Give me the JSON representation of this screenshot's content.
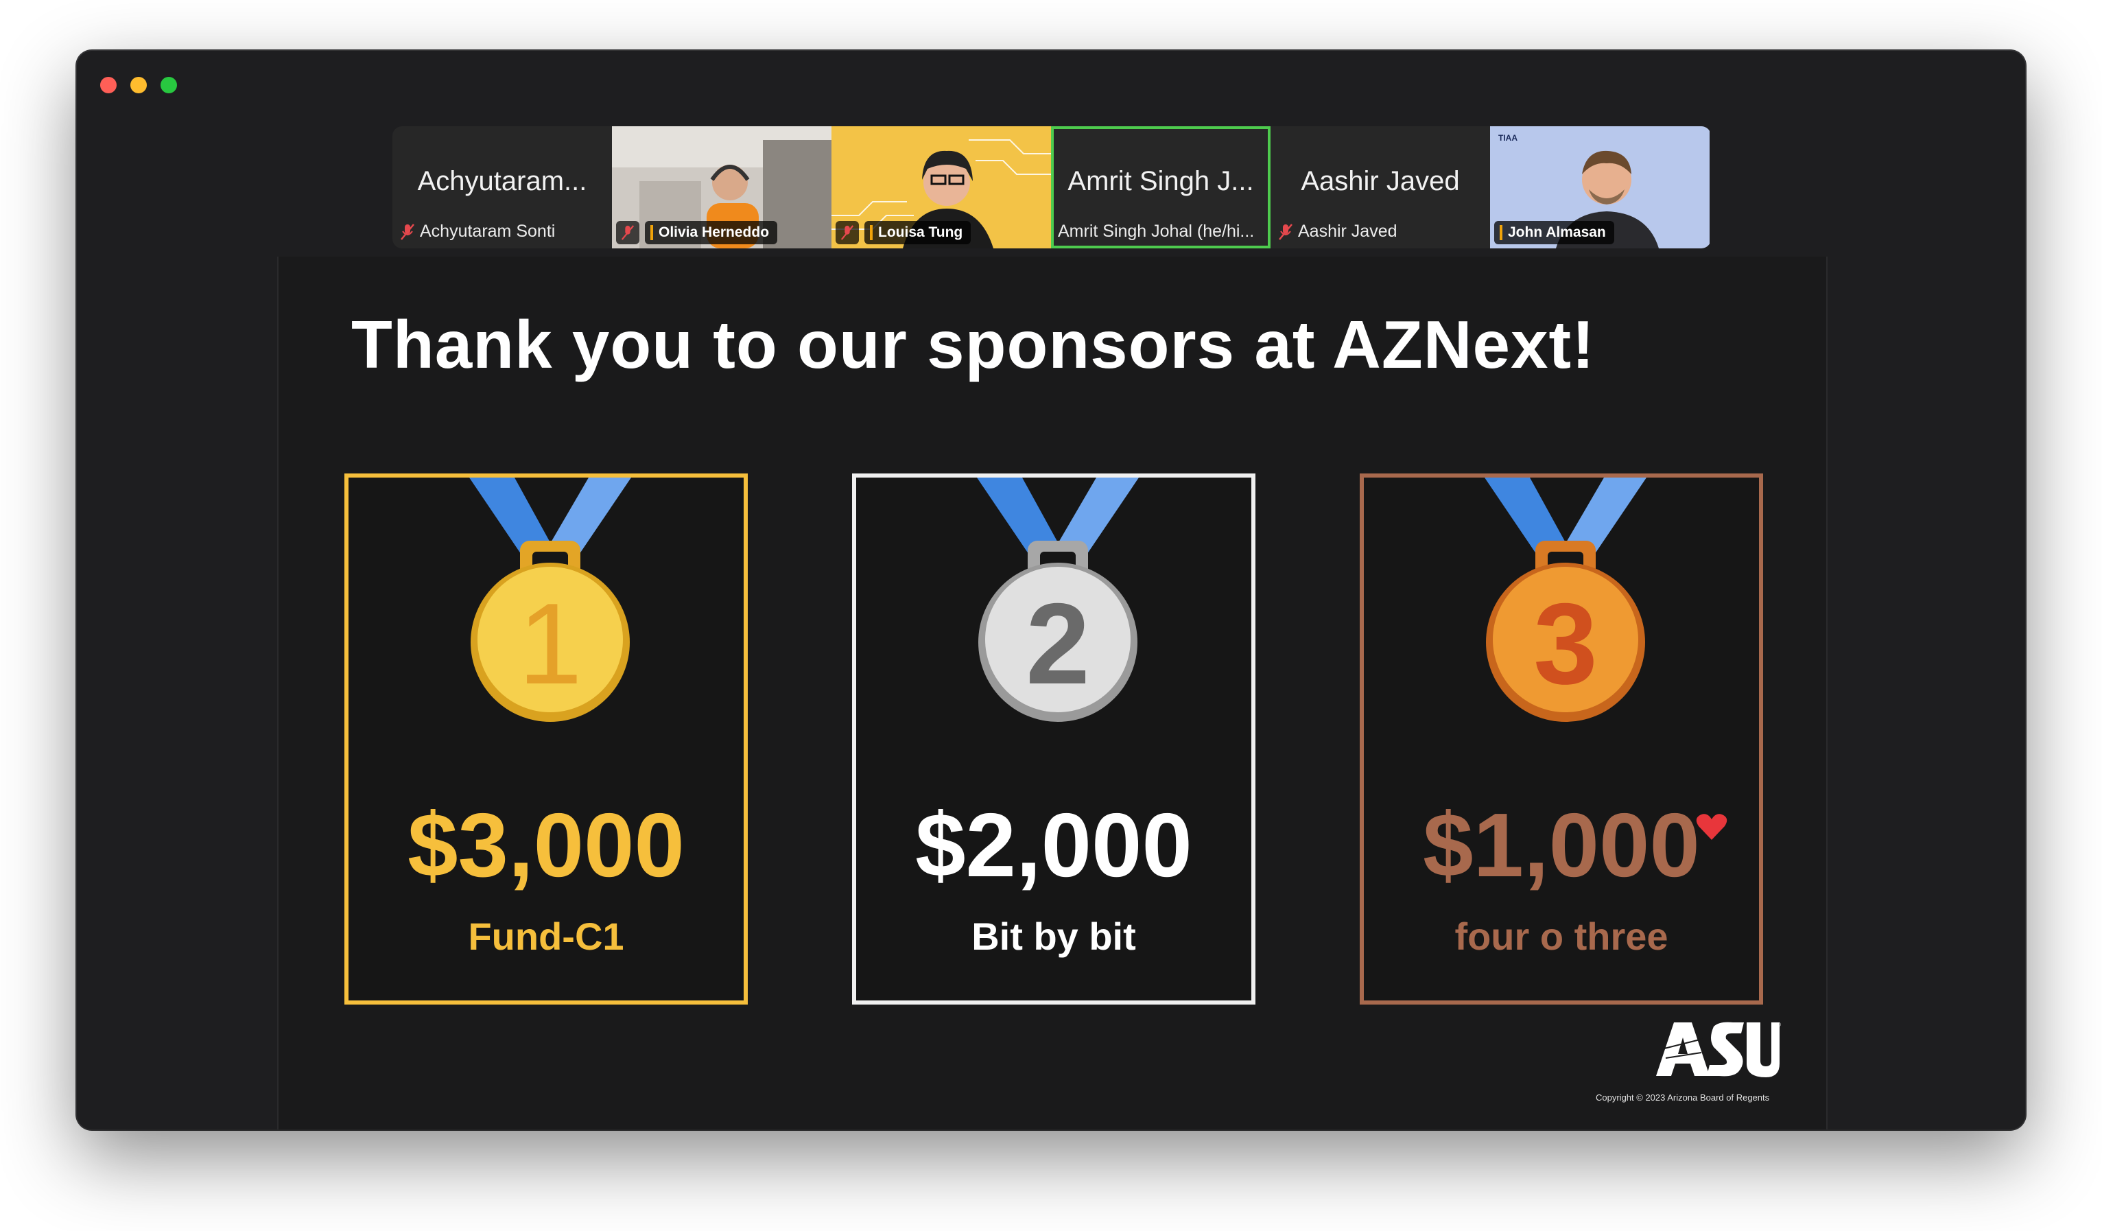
{
  "participants": [
    {
      "display_name": "Achyutaram...",
      "label": "Achyutaram Sonti",
      "muted": true,
      "video": false
    },
    {
      "display_name": "",
      "label": "Olivia Herneddo",
      "muted": true,
      "video": true
    },
    {
      "display_name": "",
      "label": "Louisa Tung",
      "muted": true,
      "video": true
    },
    {
      "display_name": "Amrit Singh J...",
      "label": "Amrit Singh Johal (he/hi...",
      "muted": false,
      "video": false,
      "active_speaker": true
    },
    {
      "display_name": "Aashir Javed",
      "label": "Aashir Javed",
      "muted": true,
      "video": false
    },
    {
      "display_name": "",
      "label": "John Almasan",
      "muted": false,
      "video": true,
      "logo_text": "TIAA"
    }
  ],
  "slide": {
    "title": "Thank you to our sponsors at AZNext!",
    "prizes": [
      {
        "place": "1",
        "amount": "$3,000",
        "sponsor": "Fund-C1",
        "color": "#f6bf3c"
      },
      {
        "place": "2",
        "amount": "$2,000",
        "sponsor": "Bit by bit",
        "color": "#ffffff"
      },
      {
        "place": "3",
        "amount": "$1,000",
        "sponsor": "four o three",
        "color": "#a8694d"
      }
    ],
    "logo": "ASU",
    "copyright": "Copyright © 2023 Arizona Board of Regents"
  },
  "colors": {
    "active_speaker_border": "#4ecb4e",
    "gold": "#f6bf3c",
    "silver": "#ffffff",
    "bronze": "#a8694d"
  }
}
